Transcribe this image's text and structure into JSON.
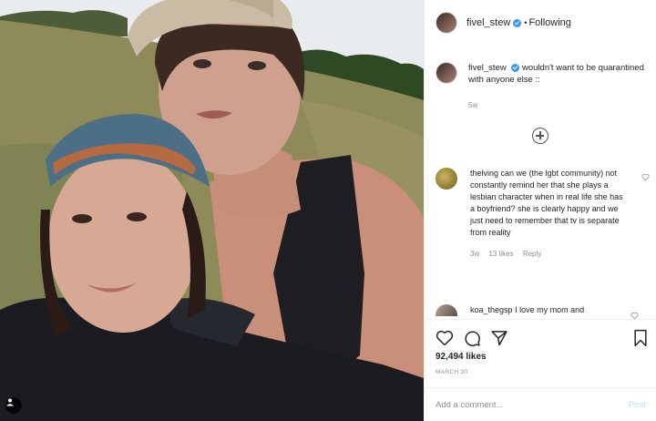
{
  "post": {
    "username": "fivel_stew",
    "follow_status": "Following",
    "separator": "•",
    "caption": "wouldn't want to be quarantined with anyone else ::",
    "caption_age": "5w"
  },
  "comments": [
    {
      "username": "thelving",
      "text": "can we (the lgbt community) not constantly remind her that she plays a lesbian character when in real life she has a boyfriend? she is clearly happy and we just need to remember that tv is separate from reality",
      "age": "3w",
      "likes": "13 likes",
      "reply": "Reply"
    },
    {
      "username": "koa_thegsp",
      "text": "I love my mom and"
    }
  ],
  "engagement": {
    "likes": "92,494 likes",
    "date": "MARCH 30"
  },
  "add_comment": {
    "placeholder": "Add a comment...",
    "post_label": "Post"
  },
  "colors": {
    "verified": "#3897f0",
    "post_disabled": "#b2dffc",
    "meta_text": "#8e8e8e"
  },
  "icons": {
    "like": "heart-icon",
    "comment": "comment-icon",
    "share": "paper-plane-icon",
    "save": "bookmark-icon",
    "add": "plus-circle-icon",
    "tags": "user-tag-icon"
  }
}
